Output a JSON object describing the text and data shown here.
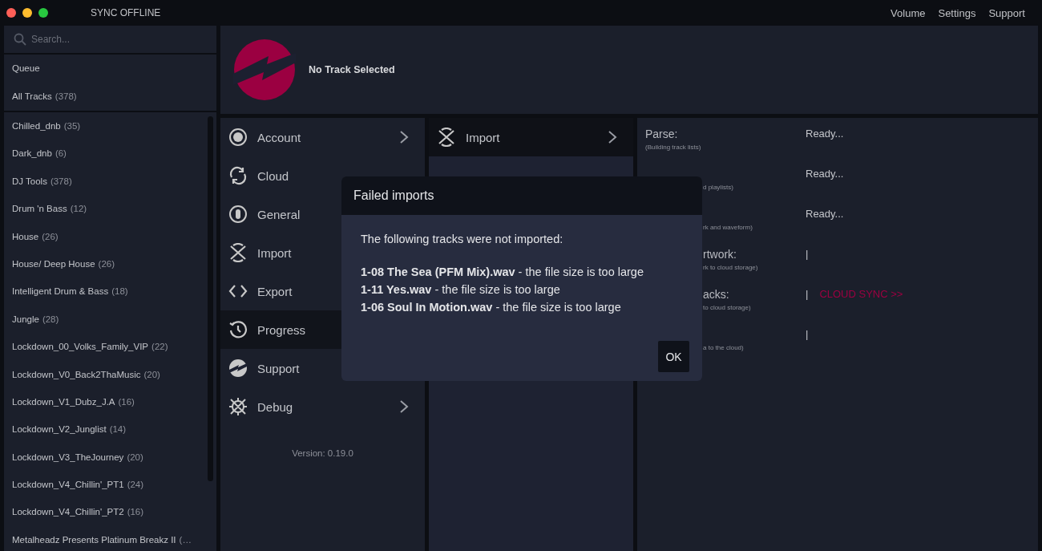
{
  "window": {
    "title": "SYNC OFFLINE",
    "menu": [
      "Volume",
      "Settings",
      "Support"
    ]
  },
  "sidebar": {
    "search": {
      "placeholder": "Search..."
    },
    "top_items": [
      {
        "name": "Queue",
        "selected": false
      },
      {
        "name": "All Tracks",
        "count": "(378)",
        "selected": false
      }
    ],
    "playlists": [
      {
        "name": "Chilled_dnb",
        "count": "(35)"
      },
      {
        "name": "Dark_dnb",
        "count": "(6)"
      },
      {
        "name": "DJ Tools",
        "count": "(378)"
      },
      {
        "name": "Drum 'n Bass",
        "count": "(12)"
      },
      {
        "name": "House",
        "count": "(26)"
      },
      {
        "name": "House/ Deep House",
        "count": "(26)"
      },
      {
        "name": "Intelligent Drum & Bass",
        "count": "(18)"
      },
      {
        "name": "Jungle",
        "count": "(28)"
      },
      {
        "name": "Lockdown_00_Volks_Family_VIP",
        "count": "(22)"
      },
      {
        "name": "Lockdown_V0_Back2ThaMusic",
        "count": "(20)"
      },
      {
        "name": "Lockdown_V1_Dubz_J.A",
        "count": "(16)"
      },
      {
        "name": "Lockdown_V2_Junglist",
        "count": "(14)"
      },
      {
        "name": "Lockdown_V3_TheJourney",
        "count": "(20)"
      },
      {
        "name": "Lockdown_V4_Chillin'_PT1",
        "count": "(24)"
      },
      {
        "name": "Lockdown_V4_Chillin'_PT2",
        "count": "(16)"
      },
      {
        "name": "Metalheadz Presents Platinum Breakz II",
        "count": "(…"
      }
    ]
  },
  "now_playing": {
    "title": "No Track Selected"
  },
  "menu": [
    {
      "label": "Account",
      "selected": false,
      "chevron": true
    },
    {
      "label": "Cloud",
      "selected": false,
      "chevron": false
    },
    {
      "label": "General",
      "selected": false,
      "chevron": false
    },
    {
      "label": "Import",
      "selected": false,
      "chevron": false
    },
    {
      "label": "Export",
      "selected": false,
      "chevron": false
    },
    {
      "label": "Progress",
      "selected": true,
      "chevron": false
    },
    {
      "label": "Support",
      "selected": false,
      "chevron": false
    },
    {
      "label": "Debug",
      "selected": false,
      "chevron": true
    }
  ],
  "version": "Version: 0.19.0",
  "submenu": [
    {
      "label": "Import",
      "selected": true,
      "chevron": true
    }
  ],
  "progress": [
    {
      "kind": "full",
      "label": "Parse:",
      "sub": "(Building track lists)",
      "status": "Ready..."
    },
    {
      "kind": "cut",
      "sub": "d playlists)",
      "status": "Ready..."
    },
    {
      "kind": "cut",
      "sub": "rk and waveform)",
      "status": "Ready..."
    },
    {
      "kind": "cut",
      "label": "rtwork:",
      "sub": "rk to cloud storage)",
      "status": "|"
    },
    {
      "kind": "cut",
      "label": "acks:",
      "sub": "to cloud storage)",
      "status": "|",
      "link": "CLOUD SYNC >>"
    },
    {
      "kind": "cut",
      "sub": "a to the cloud)",
      "status": "|"
    }
  ],
  "dialog": {
    "title": "Failed imports",
    "intro": "The following tracks were not imported:",
    "lines": [
      "**1-08 The Sea (PFM Mix).wav** - the file size is too large",
      "**1-11 Yes.wav** - the file size is too large",
      "**1-06 Soul In Motion.wav** - the file size is too large"
    ],
    "button": "OK"
  }
}
